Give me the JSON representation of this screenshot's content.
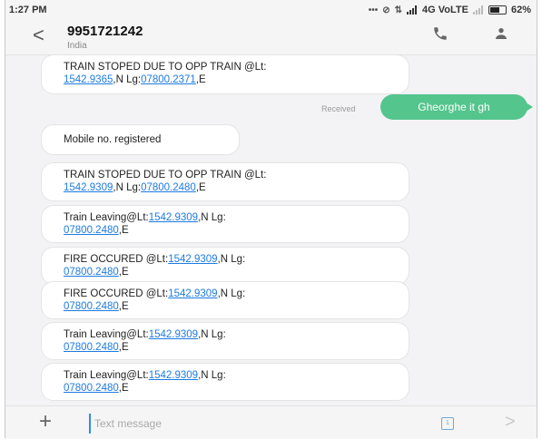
{
  "status_bar": {
    "time": "1:27 PM",
    "network": "4G VoLTE",
    "battery": "62%",
    "icons": [
      "more-dots-icon",
      "no-sim-icon",
      "data-arrows-icon",
      "signal-icon",
      "battery-icon"
    ]
  },
  "header": {
    "contact": "9951721242",
    "subtitle": "India",
    "icons": [
      "back-icon",
      "call-icon",
      "contact-icon"
    ]
  },
  "thread": {
    "messages": [
      {
        "direction": "in",
        "parts": [
          "TRAIN STOPED DUE TO OPP TRAIN @Lt:",
          "1542.9365",
          ",N Lg:",
          "07800.2371",
          ",E"
        ]
      },
      {
        "direction": "out",
        "label": "Received",
        "text": "Gheorghe it gh"
      },
      {
        "direction": "in",
        "parts": [
          "Mobile no. registered"
        ]
      },
      {
        "direction": "in",
        "parts": [
          "TRAIN STOPED DUE TO OPP TRAIN @Lt:",
          "1542.9309",
          ",N Lg:",
          "07800.2480",
          ",E"
        ]
      },
      {
        "direction": "in",
        "parts": [
          "Train Leaving@Lt:",
          "1542.9309",
          ",N Lg:",
          "07800.2480",
          ",E"
        ]
      },
      {
        "direction": "in",
        "parts": [
          "FIRE OCCURED @Lt:",
          "1542.9309",
          ",N Lg:",
          "07800.2480",
          ",E"
        ]
      },
      {
        "direction": "in",
        "parts": [
          "FIRE OCCURED @Lt:",
          "1542.9309",
          ",N Lg:",
          "07800.2480",
          ",E"
        ]
      },
      {
        "direction": "in",
        "parts": [
          "Train Leaving@Lt:",
          "1542.9309",
          ",N Lg:",
          "07800.2480",
          ",E"
        ]
      },
      {
        "direction": "in",
        "parts": [
          "Train Leaving@Lt:",
          "1542.9309",
          ",N Lg:",
          "07800.2480",
          ",E"
        ]
      }
    ]
  },
  "composer": {
    "placeholder": "Text message",
    "sim_label": "1",
    "icons": [
      "add-icon",
      "sim-icon",
      "send-icon"
    ]
  },
  "colors": {
    "link": "#1e7be0",
    "outgoing_bubble": "#54c58d",
    "cursor": "#2f8fe0"
  }
}
